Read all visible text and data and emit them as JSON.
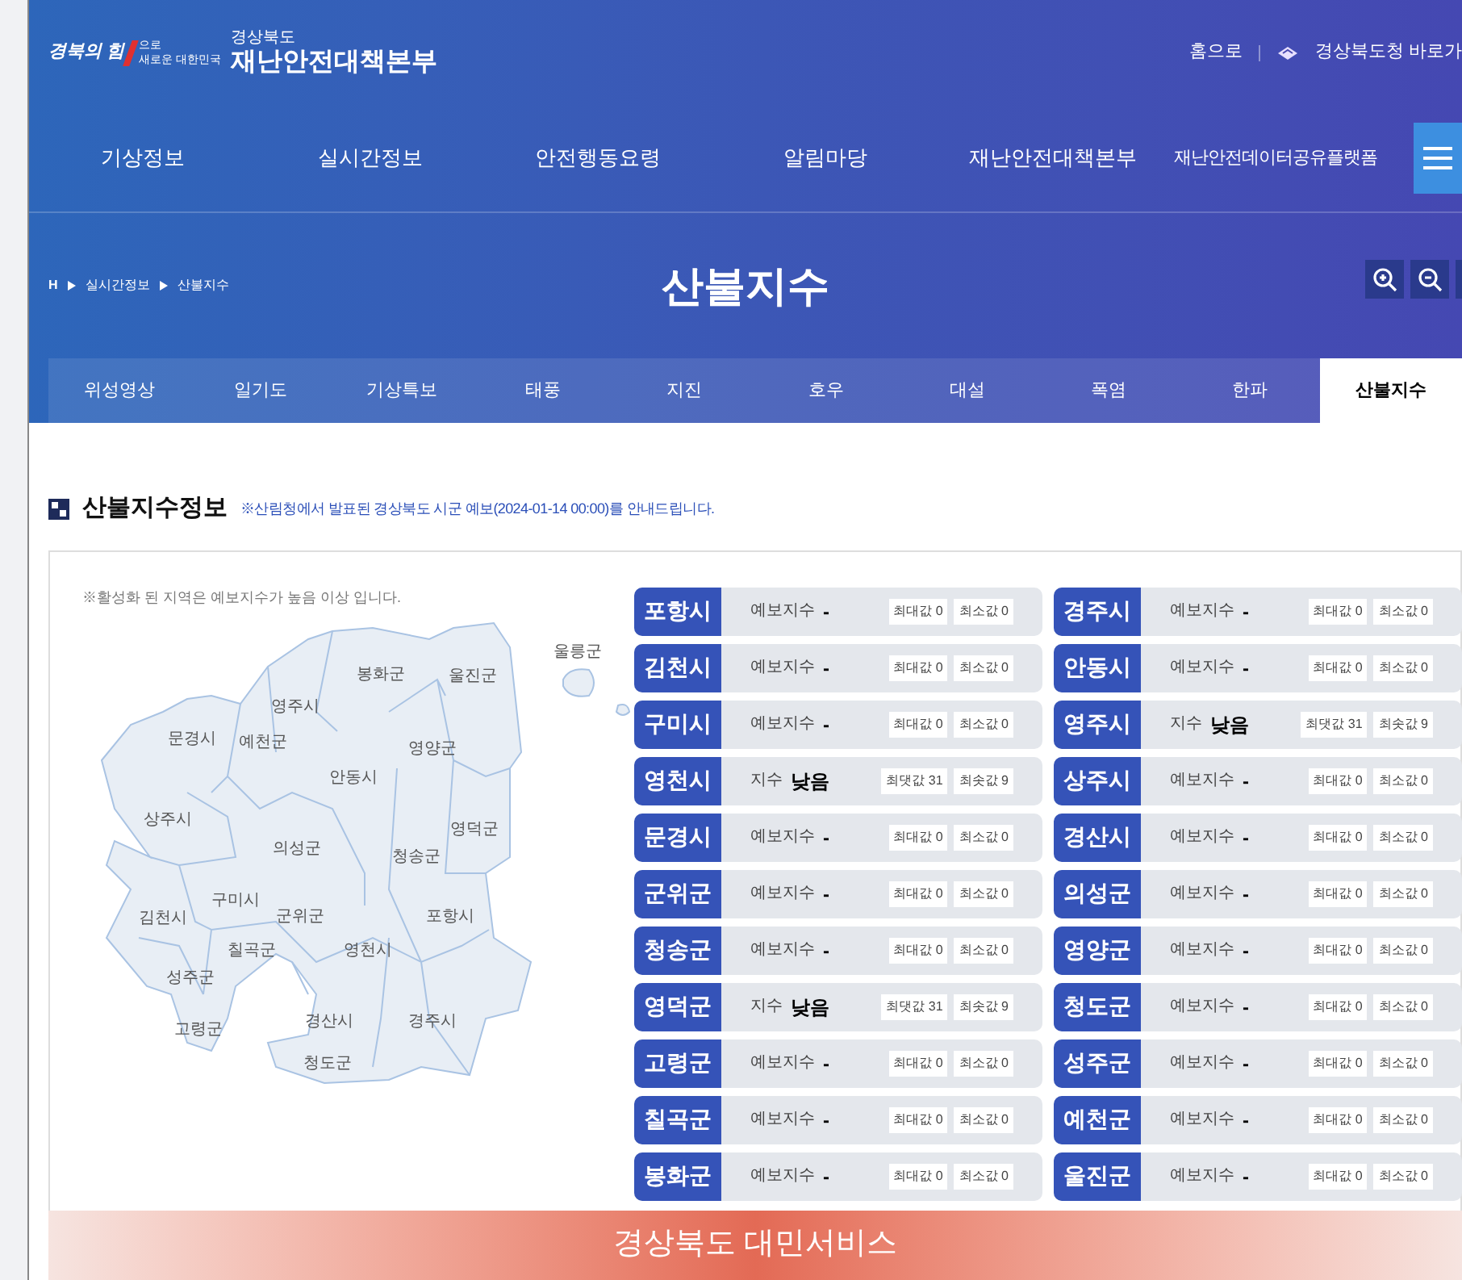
{
  "header": {
    "slogan_main": "경북의 힘",
    "slogan_top": "으로",
    "slogan_bottom": "새로운 대한민국",
    "org_top": "경상북도",
    "org_name": "재난안전대책본부",
    "links": [
      "홈으로",
      "경상북도청 바로가"
    ]
  },
  "nav": [
    "기상정보",
    "실시간정보",
    "안전행동요령",
    "알림마당",
    "재난안전대책본부",
    "재난안전데이터공유플랫폼"
  ],
  "breadcrumb": [
    "H",
    "실시간정보",
    "산불지수"
  ],
  "page_title": "산불지수",
  "tabs": [
    {
      "label": "위성영상",
      "selected": false
    },
    {
      "label": "일기도",
      "selected": false
    },
    {
      "label": "기상특보",
      "selected": false
    },
    {
      "label": "태풍",
      "selected": false
    },
    {
      "label": "지진",
      "selected": false
    },
    {
      "label": "호우",
      "selected": false
    },
    {
      "label": "대설",
      "selected": false
    },
    {
      "label": "폭염",
      "selected": false
    },
    {
      "label": "한파",
      "selected": false
    },
    {
      "label": "산불지수",
      "selected": true
    }
  ],
  "section": {
    "title": "산불지수정보",
    "note": "※산림청에서 발표된 경상북도 시군 예보(2024-01-14 00:00)를 안내드립니다."
  },
  "map": {
    "note": "※활성화 된 지역은 예보지수가 높음 이상 입니다.",
    "regions": [
      "울릉군",
      "봉화군",
      "울진군",
      "영주시",
      "문경시",
      "예천군",
      "영양군",
      "안동시",
      "상주시",
      "영덕군",
      "의성군",
      "청송군",
      "구미시",
      "김천시",
      "군위군",
      "포항시",
      "칠곡군",
      "영천시",
      "성주군",
      "고령군",
      "경산시",
      "경주시",
      "청도군"
    ]
  },
  "forecast_cards": [
    {
      "name": "포항시",
      "index_label": "예보지수",
      "index_value": "-",
      "max": "최대값 0",
      "min": "최소값 0"
    },
    {
      "name": "경주시",
      "index_label": "예보지수",
      "index_value": "-",
      "max": "최대값 0",
      "min": "최소값 0"
    },
    {
      "name": "김천시",
      "index_label": "예보지수",
      "index_value": "-",
      "max": "최대값 0",
      "min": "최소값 0"
    },
    {
      "name": "안동시",
      "index_label": "예보지수",
      "index_value": "-",
      "max": "최대값 0",
      "min": "최소값 0"
    },
    {
      "name": "구미시",
      "index_label": "예보지수",
      "index_value": "-",
      "max": "최대값 0",
      "min": "최소값 0"
    },
    {
      "name": "영주시",
      "index_label": "지수",
      "index_value": "낮음",
      "max": "최댓값 31",
      "min": "최솟값 9"
    },
    {
      "name": "영천시",
      "index_label": "지수",
      "index_value": "낮음",
      "max": "최댓값 31",
      "min": "최솟값 9"
    },
    {
      "name": "상주시",
      "index_label": "예보지수",
      "index_value": "-",
      "max": "최대값 0",
      "min": "최소값 0"
    },
    {
      "name": "문경시",
      "index_label": "예보지수",
      "index_value": "-",
      "max": "최대값 0",
      "min": "최소값 0"
    },
    {
      "name": "경산시",
      "index_label": "예보지수",
      "index_value": "-",
      "max": "최대값 0",
      "min": "최소값 0"
    },
    {
      "name": "군위군",
      "index_label": "예보지수",
      "index_value": "-",
      "max": "최대값 0",
      "min": "최소값 0"
    },
    {
      "name": "의성군",
      "index_label": "예보지수",
      "index_value": "-",
      "max": "최대값 0",
      "min": "최소값 0"
    },
    {
      "name": "청송군",
      "index_label": "예보지수",
      "index_value": "-",
      "max": "최대값 0",
      "min": "최소값 0"
    },
    {
      "name": "영양군",
      "index_label": "예보지수",
      "index_value": "-",
      "max": "최대값 0",
      "min": "최소값 0"
    },
    {
      "name": "영덕군",
      "index_label": "지수",
      "index_value": "낮음",
      "max": "최댓값 31",
      "min": "최솟값 9"
    },
    {
      "name": "청도군",
      "index_label": "예보지수",
      "index_value": "-",
      "max": "최대값 0",
      "min": "최소값 0"
    },
    {
      "name": "고령군",
      "index_label": "예보지수",
      "index_value": "-",
      "max": "최대값 0",
      "min": "최소값 0"
    },
    {
      "name": "성주군",
      "index_label": "예보지수",
      "index_value": "-",
      "max": "최대값 0",
      "min": "최소값 0"
    },
    {
      "name": "칠곡군",
      "index_label": "예보지수",
      "index_value": "-",
      "max": "최대값 0",
      "min": "최소값 0"
    },
    {
      "name": "예천군",
      "index_label": "예보지수",
      "index_value": "-",
      "max": "최대값 0",
      "min": "최소값 0"
    },
    {
      "name": "봉화군",
      "index_label": "예보지수",
      "index_value": "-",
      "max": "최대값 0",
      "min": "최소값 0"
    },
    {
      "name": "울진군",
      "index_label": "예보지수",
      "index_value": "-",
      "max": "최대값 0",
      "min": "최소값 0"
    }
  ],
  "banner": "경상북도 대민서비스"
}
